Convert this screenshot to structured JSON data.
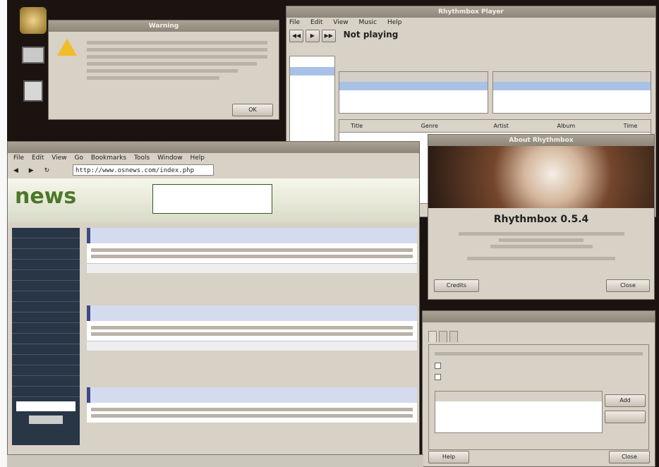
{
  "desktop": {
    "icons": [
      {
        "label": "",
        "icon": "home-icon"
      },
      {
        "label": "",
        "icon": "computer-icon"
      },
      {
        "label": "",
        "icon": "trash-icon"
      }
    ]
  },
  "warning": {
    "title": "Warning",
    "message_line1": "",
    "message_line2": "",
    "ok_label": "OK"
  },
  "rhythmbox": {
    "title": "Rhythmbox Player",
    "menu": [
      "File",
      "Edit",
      "View",
      "Music",
      "Help"
    ],
    "status": "Not playing",
    "source_items": [
      "",
      ""
    ],
    "genre_label": "",
    "artist_label": "",
    "album_label": "",
    "columns": [
      "Title",
      "Genre",
      "Artist",
      "Album",
      "Time"
    ],
    "shuffle_label": "",
    "repeat_label": ""
  },
  "about": {
    "title": "About Rhythmbox",
    "app_name": "Rhythmbox 0.5.4",
    "credits_label": "Credits",
    "close_label": "Close"
  },
  "browser": {
    "title": "",
    "menu": [
      "File",
      "Edit",
      "View",
      "Go",
      "Bookmarks",
      "Tools",
      "Window",
      "Help"
    ],
    "url": "http://www.osnews.com/index.php",
    "logo": "news",
    "ad_text": [
      "",
      "",
      ""
    ],
    "sidebar_links": [
      "",
      "",
      "",
      "",
      "",
      "",
      "",
      "",
      "",
      "",
      "",
      "",
      "",
      "",
      "",
      ""
    ],
    "articles": [
      {
        "title": "",
        "highlight": ""
      },
      {
        "title": "",
        "highlight": ""
      },
      {
        "title": "",
        "highlight": ""
      }
    ]
  },
  "prefs": {
    "title": "",
    "tabs": [
      "",
      "",
      ""
    ],
    "check1": "",
    "check2": "",
    "list_header": "",
    "add_label": "Add",
    "remove_label": "",
    "help_label": "Help",
    "close_label": "Close"
  },
  "taskbar": {
    "items": [
      "",
      "",
      "",
      "",
      ""
    ]
  }
}
